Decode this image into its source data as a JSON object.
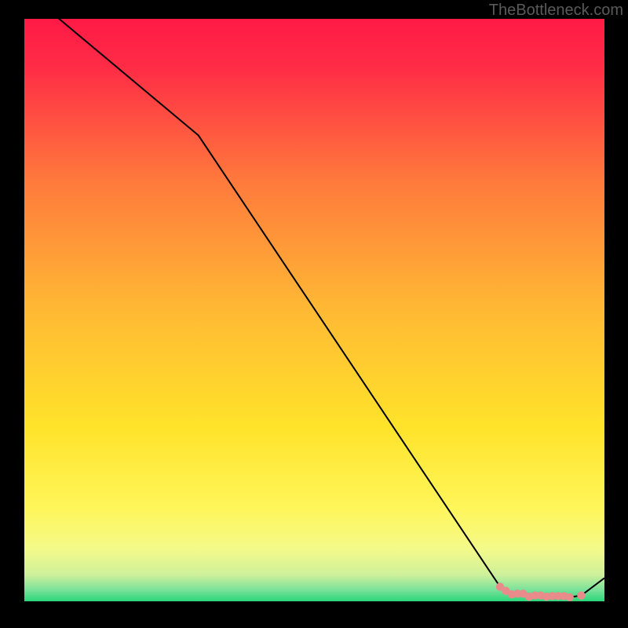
{
  "watermark": "TheBottleneck.com",
  "chart_data": {
    "type": "line",
    "title": "",
    "xlabel": "",
    "ylabel": "",
    "xlim": [
      0,
      100
    ],
    "ylim": [
      0,
      100
    ],
    "grid": false,
    "legend": false,
    "background": "gradient:red-yellow-green",
    "series": [
      {
        "name": "curve",
        "x": [
          0,
          30,
          82,
          84,
          86,
          87,
          89,
          90,
          93,
          94,
          96,
          100
        ],
        "y": [
          105,
          80,
          2.5,
          1.2,
          1.3,
          0.8,
          1.0,
          0.8,
          0.9,
          0.7,
          1.0,
          4.0
        ]
      }
    ],
    "markers": {
      "name": "pink-dots",
      "color": "#e98b8b",
      "points": [
        {
          "x": 82,
          "y": 2.5
        },
        {
          "x": 83,
          "y": 1.8
        },
        {
          "x": 84,
          "y": 1.2
        },
        {
          "x": 85,
          "y": 1.3
        },
        {
          "x": 86,
          "y": 1.3
        },
        {
          "x": 87,
          "y": 0.8
        },
        {
          "x": 88,
          "y": 1.0
        },
        {
          "x": 89,
          "y": 1.0
        },
        {
          "x": 90,
          "y": 0.8
        },
        {
          "x": 91,
          "y": 0.9
        },
        {
          "x": 92,
          "y": 0.9
        },
        {
          "x": 93,
          "y": 0.9
        },
        {
          "x": 94,
          "y": 0.7
        },
        {
          "x": 96,
          "y": 1.0
        }
      ]
    }
  },
  "colors": {
    "gradient_top": "#ff1a46",
    "gradient_mid": "#ffe428",
    "gradient_bottom": "#2bd67a",
    "line": "#000000",
    "marker": "#e98b8b"
  }
}
